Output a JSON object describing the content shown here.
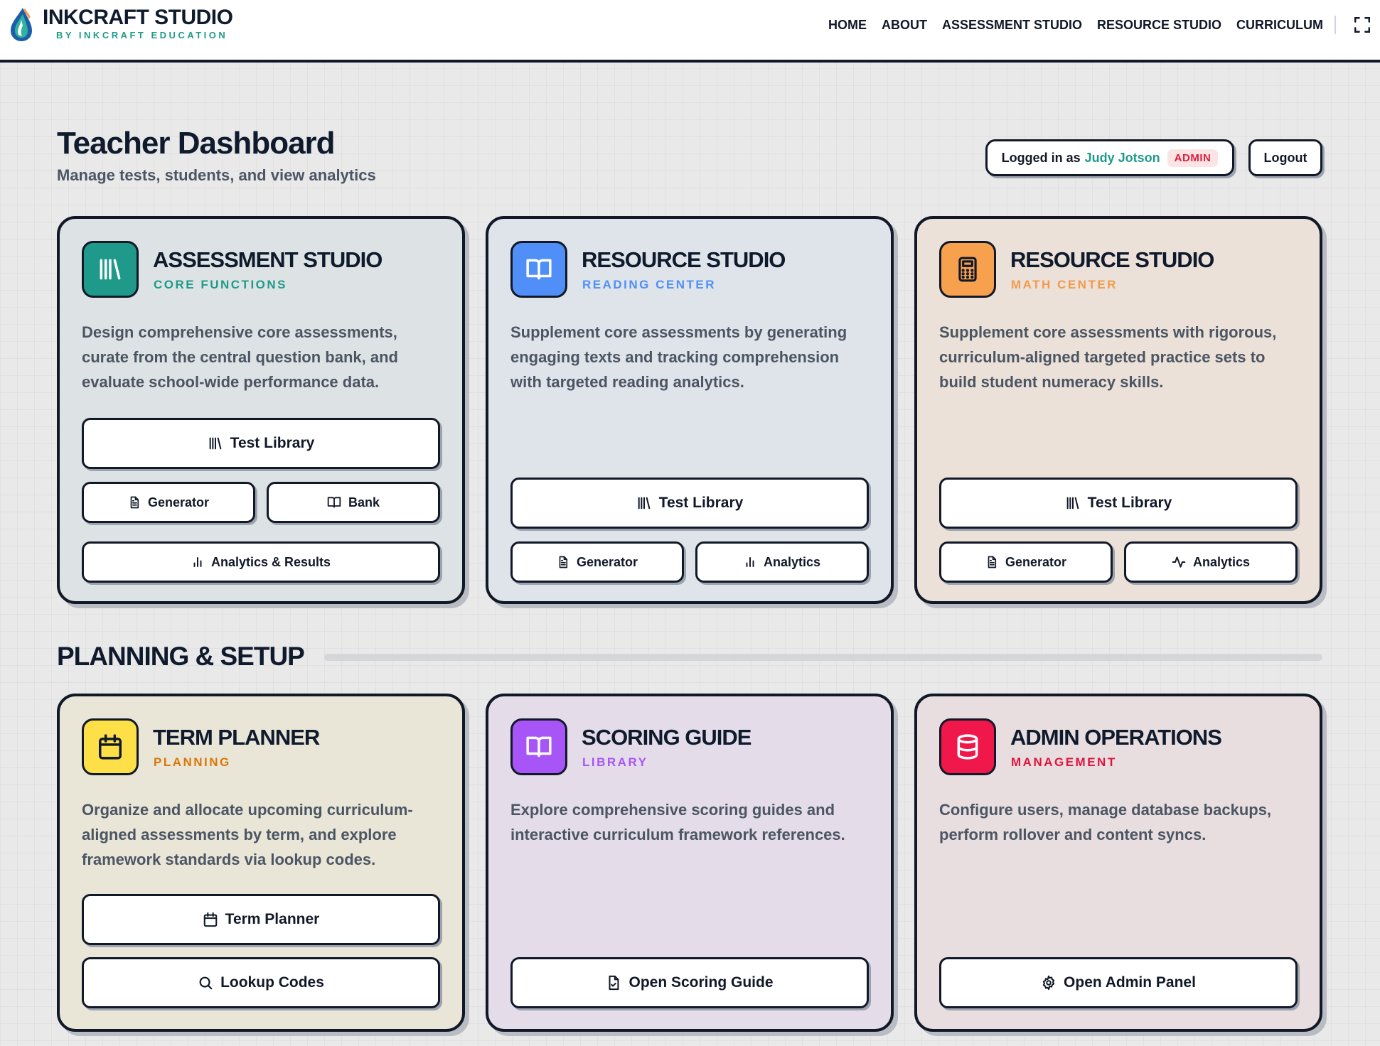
{
  "brand": {
    "title": "INKCRAFT STUDIO",
    "subtitle": "BY INKCRAFT EDUCATION"
  },
  "nav": [
    "HOME",
    "ABOUT",
    "ASSESSMENT STUDIO",
    "RESOURCE STUDIO",
    "CURRICULUM"
  ],
  "page": {
    "title": "Teacher Dashboard",
    "subtitle": "Manage tests, students, and view analytics"
  },
  "user": {
    "prefix": "Logged in as",
    "name": "Judy Jotson",
    "role": "ADMIN",
    "logout_label": "Logout"
  },
  "cards": [
    {
      "title": "ASSESSMENT STUDIO",
      "tag": "CORE FUNCTIONS",
      "desc": "Design comprehensive core assessments, curate from the central question bank, and evaluate school-wide performance data.",
      "icon": "library-icon",
      "accent": "#1f9a8a",
      "buttons": {
        "test_library": "Test Library",
        "generator": "Generator",
        "bank": "Bank",
        "analytics": "Analytics & Results"
      }
    },
    {
      "title": "RESOURCE STUDIO",
      "tag": "READING CENTER",
      "desc": "Supplement core assessments by generating engaging texts and tracking comprehension with targeted reading analytics.",
      "icon": "book-open-icon",
      "accent": "#4f8ff7",
      "buttons": {
        "test_library": "Test Library",
        "generator": "Generator",
        "analytics": "Analytics"
      }
    },
    {
      "title": "RESOURCE STUDIO",
      "tag": "MATH CENTER",
      "desc": "Supplement core assessments with rigorous, curriculum-aligned targeted practice sets to build student numeracy skills.",
      "icon": "calculator-icon",
      "accent": "#f39a4a",
      "buttons": {
        "test_library": "Test Library",
        "generator": "Generator",
        "analytics": "Analytics"
      }
    }
  ],
  "section": {
    "title": "PLANNING & SETUP"
  },
  "cards2": [
    {
      "title": "TERM PLANNER",
      "tag": "PLANNING",
      "desc": "Organize and allocate upcoming curriculum-aligned assessments by term, and explore framework standards via lookup codes.",
      "icon": "calendar-icon",
      "accent": "#fde047",
      "tag_color": "#d97706",
      "buttons": {
        "term_planner": "Term Planner",
        "lookup": "Lookup Codes"
      }
    },
    {
      "title": "SCORING GUIDE",
      "tag": "LIBRARY",
      "desc": "Explore comprehensive scoring guides and interactive curriculum framework references.",
      "icon": "book-open-icon",
      "accent": "#a855f7",
      "buttons": {
        "open": "Open Scoring Guide"
      }
    },
    {
      "title": "ADMIN OPERATIONS",
      "tag": "MANAGEMENT",
      "desc": "Configure users, manage database backups, perform rollover and content syncs.",
      "icon": "database-icon",
      "accent": "#f0174a",
      "buttons": {
        "open": "Open Admin Panel"
      }
    }
  ]
}
